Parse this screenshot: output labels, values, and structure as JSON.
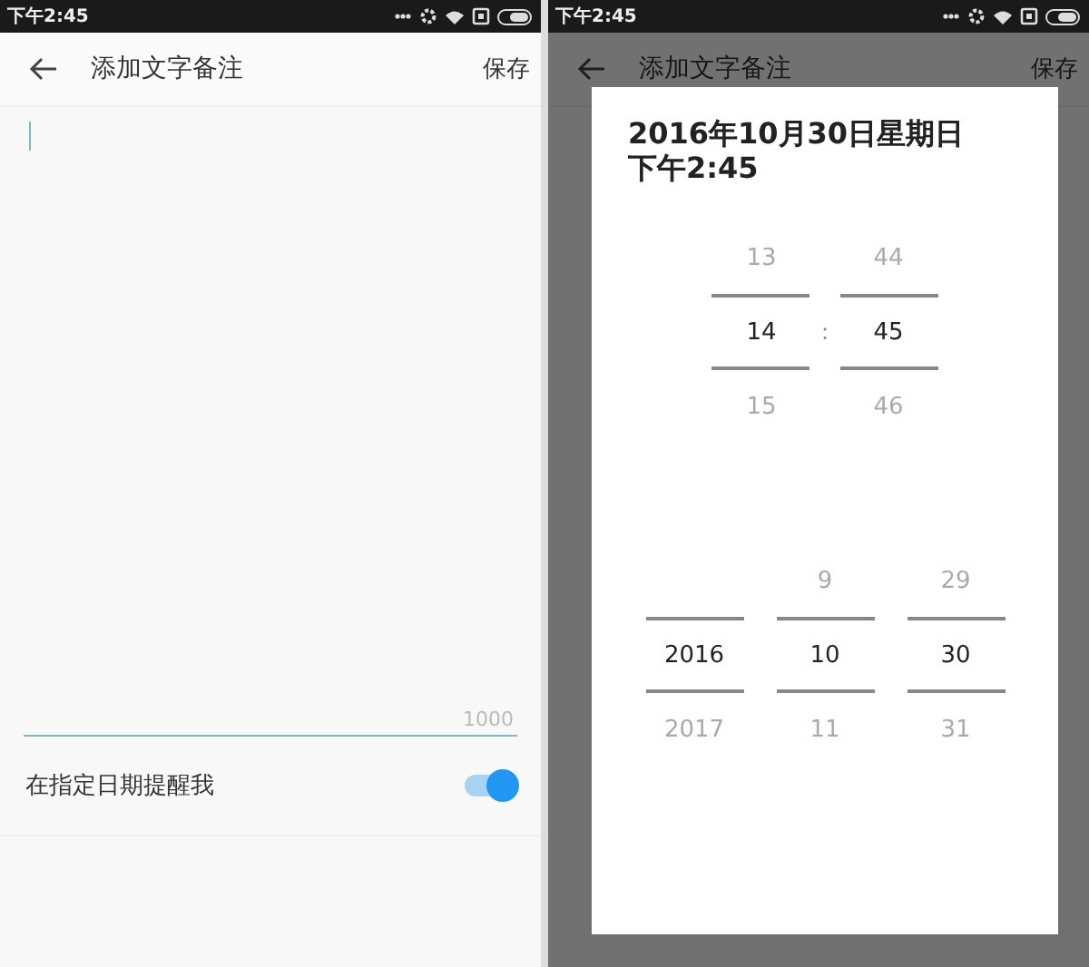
{
  "left_screen": {
    "status_bar": {
      "time": "下午2:45"
    },
    "app_bar": {
      "title": "添加文字备注",
      "action": "保存"
    },
    "note_field": {
      "counter": "1000"
    },
    "reminder": {
      "label": "在指定日期提醒我",
      "on": true
    }
  },
  "right_screen": {
    "status_bar": {
      "time": "下午2:45"
    },
    "app_bar": {
      "title": "添加文字备注",
      "action": "保存"
    },
    "dialog": {
      "date_title": "2016年10月30日星期日",
      "time_title": "下午2:45",
      "time_picker": {
        "separator": ":",
        "columns": [
          {
            "above": "13",
            "value": "14",
            "below": "15"
          },
          {
            "above": "44",
            "value": "45",
            "below": "46"
          }
        ]
      },
      "date_picker": {
        "columns": [
          {
            "value": "2016",
            "below": "2017"
          },
          {
            "above": "9",
            "value": "10",
            "below": "11"
          },
          {
            "above": "29",
            "value": "30",
            "below": "31"
          }
        ]
      }
    }
  }
}
